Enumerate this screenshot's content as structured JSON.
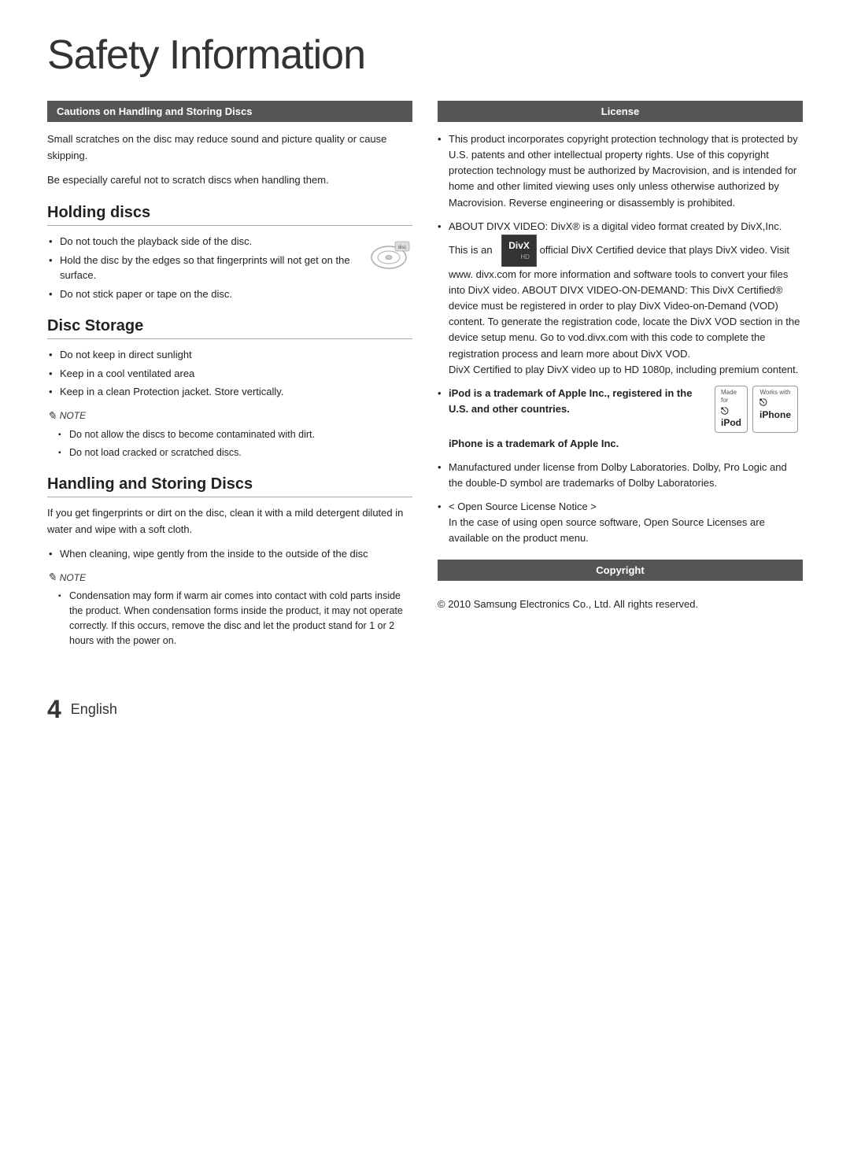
{
  "page": {
    "title": "Safety Information",
    "page_number": "4",
    "language": "English"
  },
  "left": {
    "cautions_header": "Cautions on Handling and Storing Discs",
    "cautions_intro1": "Small scratches on the disc may reduce sound and picture quality or cause skipping.",
    "cautions_intro2": "Be especially careful not to scratch discs when handling them.",
    "holding_discs": {
      "title": "Holding discs",
      "bullets": [
        "Do not touch the playback side of the disc.",
        "Hold the disc by the edges so that fingerprints will not get on the surface.",
        "Do not stick paper or tape on the disc."
      ]
    },
    "disc_storage": {
      "title": "Disc Storage",
      "bullets": [
        "Do not keep in direct sunlight",
        "Keep in a cool ventilated area",
        "Keep in a clean Protection jacket. Store vertically."
      ],
      "note_label": "NOTE",
      "note_items": [
        "Do not allow the discs to become contaminated with dirt.",
        "Do not load cracked or scratched discs."
      ]
    },
    "handling": {
      "title": "Handling and Storing Discs",
      "intro": "If you get fingerprints or dirt on the disc, clean it with a mild detergent diluted in water and wipe with a soft cloth.",
      "bullets": [
        "When cleaning, wipe gently from the inside to the outside of the disc"
      ],
      "note_label": "NOTE",
      "note_items": [
        "Condensation may form if warm air comes into contact with cold parts inside the product. When condensation forms inside the product, it may not operate correctly. If this occurs, remove the disc and let the product stand for 1 or 2 hours with the power on."
      ]
    }
  },
  "right": {
    "license_header": "License",
    "license_p1": "This product incorporates copyright protection technology that is protected by U.S. patents and other intellectual property rights. Use of this copyright protection technology must be authorized by Macrovision, and is intended for home and other limited viewing uses only unless otherwise authorized by Macrovision. Reverse engineering or disassembly is prohibited.",
    "divx_section": "ABOUT DIVX VIDEO: DivX® is a digital video format created by DivX,Inc. This is an official DivX Certified device that plays DivX video. Visit www. divx.com for more information and software tools to convert your files into DivX video. ABOUT DIVX VIDEO-ON-DEMAND: This DivX Certified® device must be registered in order to play DivX Video-on-Demand (VOD) content. To generate the registration code, locate the DivX VOD section in the device setup menu. Go to vod.divx.com with this code to complete the registration process and learn more about DivX VOD.",
    "divx_certified": "DivX Certified to play DivX video up to HD 1080p, including premium content.",
    "divx_logo_label": "DivX HD",
    "ipod_trademark": "iPod is a trademark of Apple Inc., registered in the U.S. and other countries.",
    "ipod_badge_top": "Made for",
    "ipod_badge_main": "iPod",
    "iphone_badge_top": "Works with",
    "iphone_badge_main": "iPhone",
    "iphone_trademark": "iPhone is a trademark of Apple Inc.",
    "dolby_text": "Manufactured under license from Dolby Laboratories. Dolby, Pro Logic and the double-D symbol are trademarks of Dolby Laboratories.",
    "open_source_link": "< Open Source License Notice >",
    "open_source_text": "In the case of using open source software, Open Source Licenses are available on the product menu.",
    "copyright_header": "Copyright",
    "copyright_text": "© 2010 Samsung Electronics Co., Ltd. All rights reserved."
  }
}
